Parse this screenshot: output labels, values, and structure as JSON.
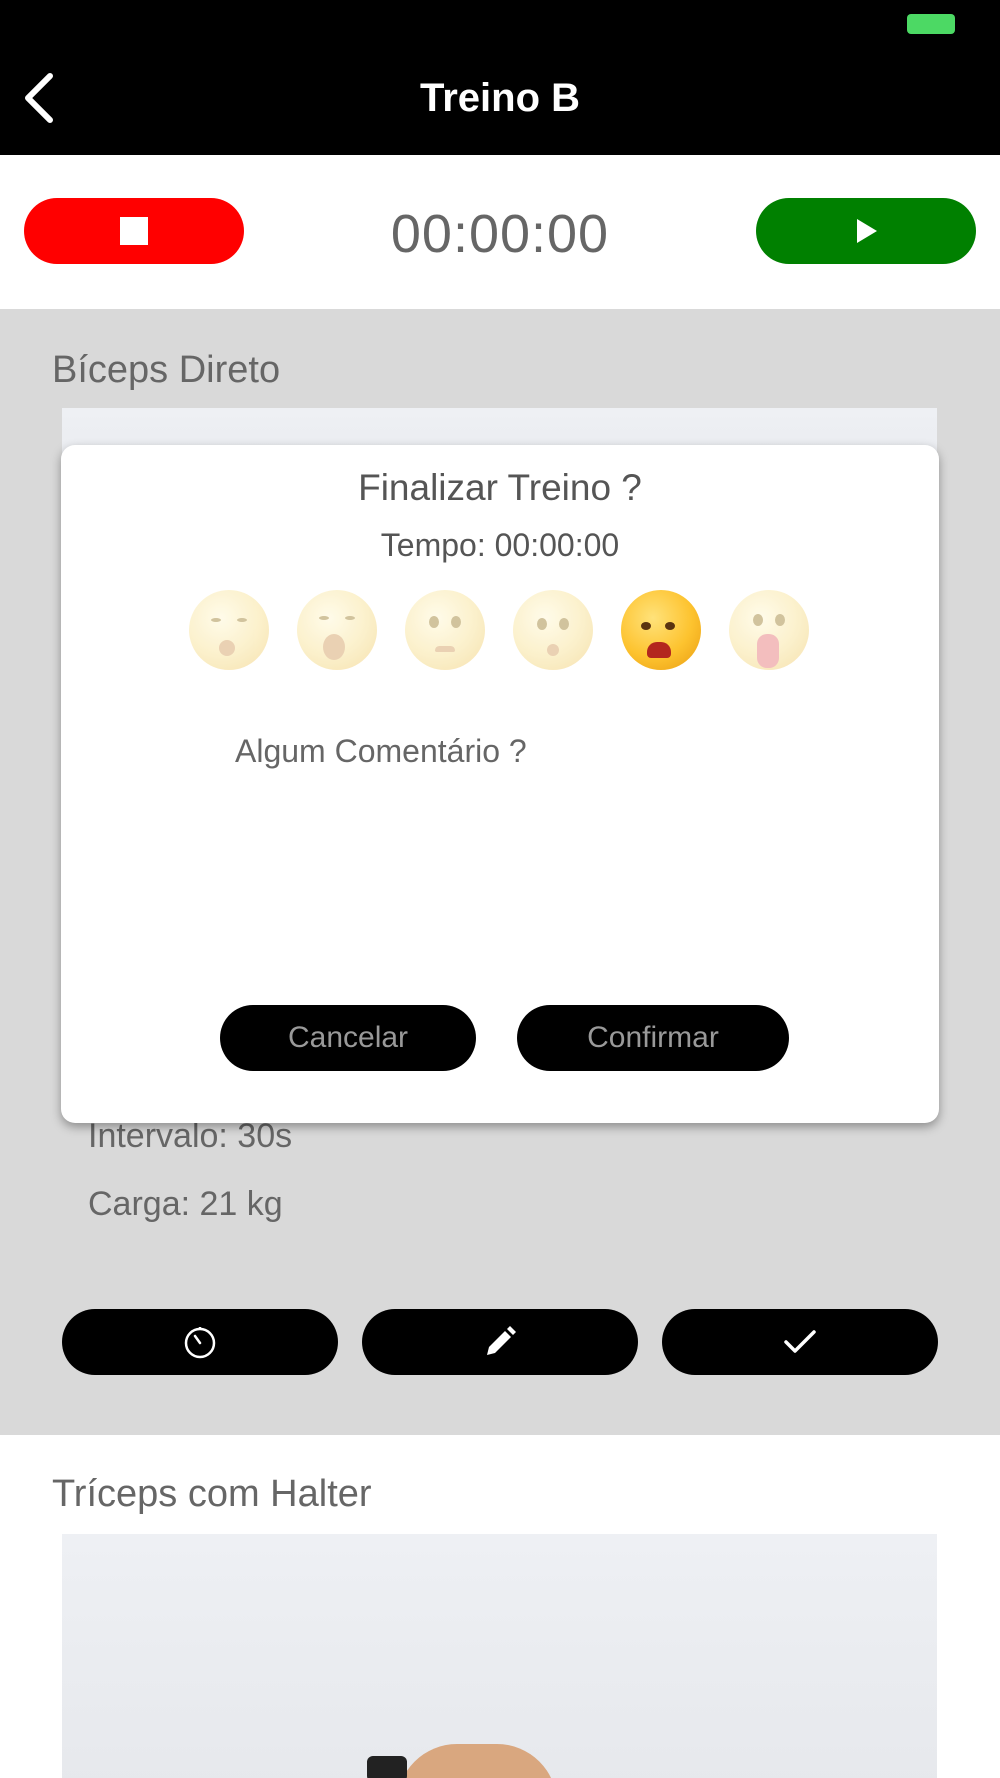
{
  "header": {
    "title": "Treino B",
    "back_icon": "chevron-left-icon",
    "battery_color": "#4cd964"
  },
  "timer_bar": {
    "elapsed": "00:00:00",
    "stop_icon": "stop-icon",
    "play_icon": "play-icon",
    "stop_color": "#ff0000",
    "play_color": "#008000"
  },
  "exercises": [
    {
      "name": "Bíceps Direto",
      "interval": "Intervalo: 30s",
      "load": "Carga: 21 kg",
      "actions": [
        "timer-icon",
        "pencil-icon",
        "checkmark-icon"
      ]
    },
    {
      "name": "Tríceps com Halter"
    }
  ],
  "modal": {
    "title": "Finalizar Treino ?",
    "time": "Tempo: 00:00:00",
    "emojis": [
      {
        "name": "sleeping-face-icon",
        "selected": false
      },
      {
        "name": "yawning-face-icon",
        "selected": false
      },
      {
        "name": "worried-face-icon",
        "selected": false
      },
      {
        "name": "crying-face-icon",
        "selected": false
      },
      {
        "name": "exhausted-face-icon",
        "selected": true
      },
      {
        "name": "drooling-tongue-face-icon",
        "selected": false
      }
    ],
    "comment_placeholder": "Algum Comentário ?",
    "cancel_label": "Cancelar",
    "confirm_label": "Confirmar"
  }
}
